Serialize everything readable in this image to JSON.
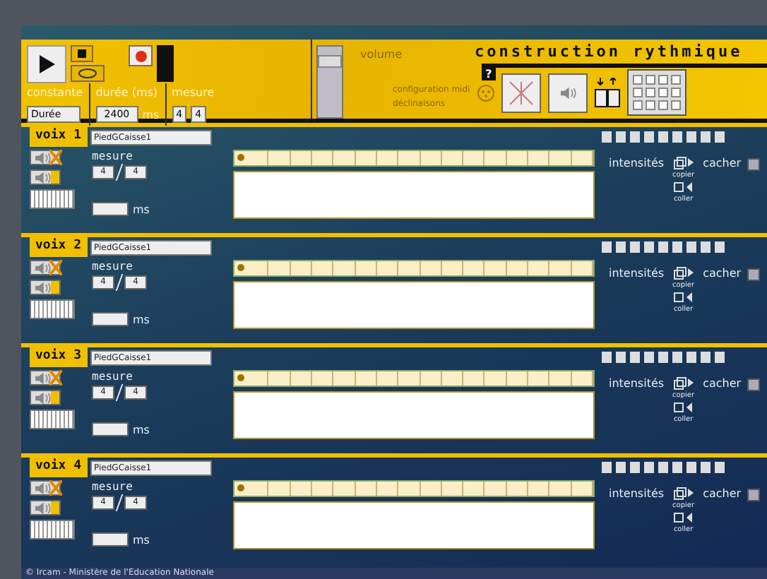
{
  "header": {
    "constante": {
      "label": "constante",
      "value": "Durée"
    },
    "duree": {
      "label": "durée (ms)",
      "value": "2400",
      "unit": "ms"
    },
    "mesure": {
      "label": "mesure",
      "numerator": "4",
      "denominator": "4"
    },
    "volume": {
      "label": "volume",
      "level": 0.85
    },
    "title": "construction rythmique",
    "help": "?",
    "links": [
      "configuration midi",
      "déclinaisons"
    ]
  },
  "voices": [
    {
      "title": "voix 1",
      "name": "PiedGCaisse1",
      "mesure_label": "mesure",
      "numerator": "4",
      "denominator": "4",
      "unit": "ms",
      "muted": true,
      "intensites": "intensités",
      "copy": "copier",
      "paste": "coller",
      "hide": "cacher",
      "hidden": false
    },
    {
      "title": "voix 2",
      "name": "PiedGCaisse1",
      "mesure_label": "mesure",
      "numerator": "4",
      "denominator": "4",
      "unit": "ms",
      "muted": true,
      "intensites": "intensités",
      "copy": "copier",
      "paste": "coller",
      "hide": "cacher",
      "hidden": false
    },
    {
      "title": "voix 3",
      "name": "PiedGCaisse1",
      "mesure_label": "mesure",
      "numerator": "4",
      "denominator": "4",
      "unit": "ms",
      "muted": true,
      "intensites": "intensités",
      "copy": "copier",
      "paste": "coller",
      "hide": "cacher",
      "hidden": false
    },
    {
      "title": "voix 4",
      "name": "PiedGCaisse1",
      "mesure_label": "mesure",
      "numerator": "4",
      "denominator": "4",
      "unit": "ms",
      "muted": true,
      "intensites": "intensités",
      "copy": "copier",
      "paste": "coller",
      "hide": "cacher",
      "hidden": false
    }
  ],
  "footer": "© Ircam - Ministère de l'Education Nationale"
}
